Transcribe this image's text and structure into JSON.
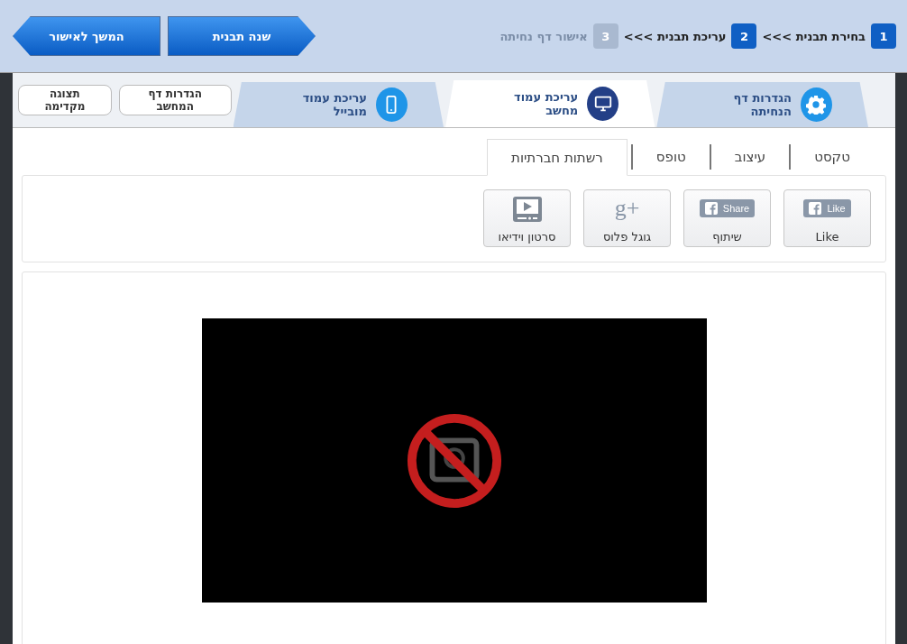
{
  "steps": [
    {
      "number": "1",
      "label": "בחירת תבנית >>>",
      "disabled": false
    },
    {
      "number": "2",
      "label": "עריכת תבנית >>>",
      "disabled": false
    },
    {
      "number": "3",
      "label": "אישור דף נחיתה",
      "disabled": true
    }
  ],
  "nav_buttons": [
    {
      "label": "שנה תבנית",
      "kind": "forward"
    },
    {
      "label": "המשך לאישור",
      "kind": "back"
    }
  ],
  "tabs": [
    {
      "label": "הגדרות דף הנחיתה",
      "kind": "settings",
      "selected": false
    },
    {
      "label": "עריכת עמוד מחשב",
      "kind": "desktop",
      "selected": true
    },
    {
      "label": "עריכת עמוד מובייל",
      "kind": "mobile",
      "selected": false
    }
  ],
  "tab_buttons": [
    "הגדרות דף המחשב",
    "תצוגה מקדימה"
  ],
  "subtabs": [
    {
      "label": "טקסט",
      "selected": false
    },
    {
      "label": "עיצוב",
      "selected": false
    },
    {
      "label": "טופס",
      "selected": false
    },
    {
      "label": "רשתות חברתיות",
      "selected": true
    }
  ],
  "widgets": [
    {
      "kind": "facebook",
      "badge": "Like",
      "label": "Like"
    },
    {
      "kind": "facebook",
      "badge": "Share",
      "label": "שיתוף"
    },
    {
      "kind": "gplus",
      "badge": "g+",
      "label": "גוגל פלוס"
    },
    {
      "kind": "video",
      "label": "סרטון וידיאו"
    }
  ],
  "video": {
    "kind": "unavailable"
  }
}
